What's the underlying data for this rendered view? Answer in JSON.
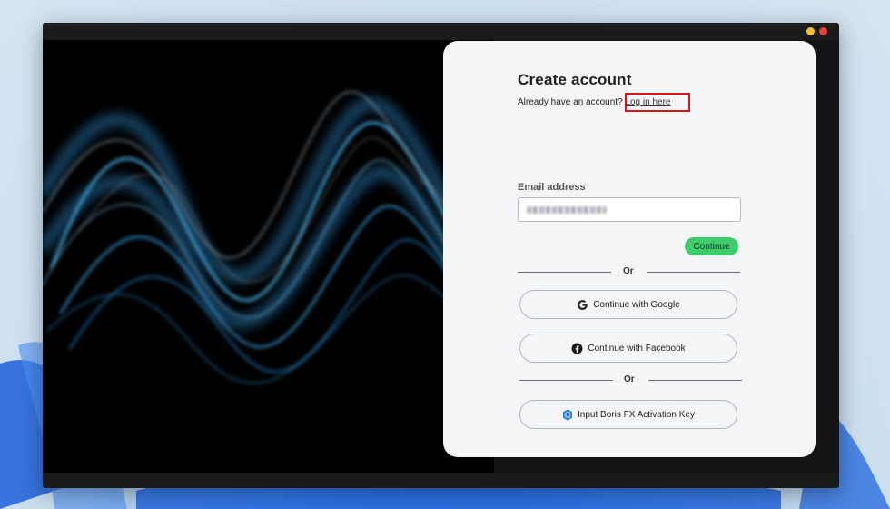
{
  "card": {
    "title": "Create account",
    "subtitle_text": "Already have an account?",
    "login_link": "Log in here",
    "email_label": "Email address",
    "email_value": "",
    "continue_label": "Continue",
    "or_1": "Or",
    "google_label": "Continue with Google",
    "facebook_label": "Continue with Facebook",
    "or_2": "Or",
    "activation_label": "Input Boris FX Activation Key"
  },
  "icons": {
    "google": "google-icon",
    "facebook": "facebook-icon",
    "activation": "boris-fx-key-icon"
  },
  "colors": {
    "continue": "#3fca6c",
    "highlight": "#d8141b",
    "facebook": "#1a1a1a",
    "activation": "#2f7ed8"
  }
}
